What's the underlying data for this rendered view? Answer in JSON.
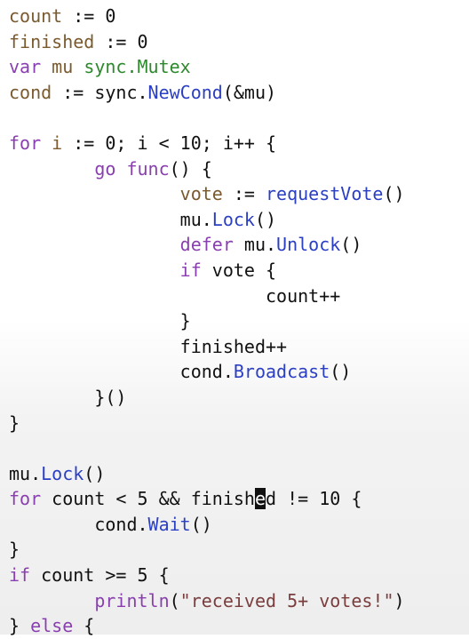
{
  "code": {
    "lines": [
      {
        "tokens": [
          {
            "t": "count",
            "c": "var"
          },
          {
            "t": " := 0",
            "c": "plain"
          }
        ]
      },
      {
        "tokens": [
          {
            "t": "finished",
            "c": "var"
          },
          {
            "t": " := 0",
            "c": "plain"
          }
        ]
      },
      {
        "tokens": [
          {
            "t": "var",
            "c": "kw"
          },
          {
            "t": " ",
            "c": "plain"
          },
          {
            "t": "mu",
            "c": "var"
          },
          {
            "t": " ",
            "c": "plain"
          },
          {
            "t": "sync.Mutex",
            "c": "type"
          }
        ]
      },
      {
        "tokens": [
          {
            "t": "cond",
            "c": "var"
          },
          {
            "t": " := sync.",
            "c": "plain"
          },
          {
            "t": "NewCond",
            "c": "fn"
          },
          {
            "t": "(&mu)",
            "c": "plain"
          }
        ]
      },
      {
        "tokens": []
      },
      {
        "tokens": [
          {
            "t": "for",
            "c": "kw"
          },
          {
            "t": " ",
            "c": "plain"
          },
          {
            "t": "i",
            "c": "var"
          },
          {
            "t": " := 0; i < 10; i++ {",
            "c": "plain"
          }
        ]
      },
      {
        "tokens": [
          {
            "t": "        ",
            "c": "plain"
          },
          {
            "t": "go",
            "c": "kw"
          },
          {
            "t": " ",
            "c": "plain"
          },
          {
            "t": "func",
            "c": "kw"
          },
          {
            "t": "() {",
            "c": "plain"
          }
        ]
      },
      {
        "tokens": [
          {
            "t": "                ",
            "c": "plain"
          },
          {
            "t": "vote",
            "c": "var"
          },
          {
            "t": " := ",
            "c": "plain"
          },
          {
            "t": "requestVote",
            "c": "fn"
          },
          {
            "t": "()",
            "c": "plain"
          }
        ]
      },
      {
        "tokens": [
          {
            "t": "                mu.",
            "c": "plain"
          },
          {
            "t": "Lock",
            "c": "fn"
          },
          {
            "t": "()",
            "c": "plain"
          }
        ]
      },
      {
        "tokens": [
          {
            "t": "                ",
            "c": "plain"
          },
          {
            "t": "defer",
            "c": "kw"
          },
          {
            "t": " mu.",
            "c": "plain"
          },
          {
            "t": "Unlock",
            "c": "fn"
          },
          {
            "t": "()",
            "c": "plain"
          }
        ]
      },
      {
        "tokens": [
          {
            "t": "                ",
            "c": "plain"
          },
          {
            "t": "if",
            "c": "kw"
          },
          {
            "t": " vote {",
            "c": "plain"
          }
        ]
      },
      {
        "tokens": [
          {
            "t": "                        count++",
            "c": "plain"
          }
        ]
      },
      {
        "tokens": [
          {
            "t": "                }",
            "c": "plain"
          }
        ]
      },
      {
        "tokens": [
          {
            "t": "                finished++",
            "c": "plain"
          }
        ]
      },
      {
        "tokens": [
          {
            "t": "                cond.",
            "c": "plain"
          },
          {
            "t": "Broadcast",
            "c": "fn"
          },
          {
            "t": "()",
            "c": "plain"
          }
        ]
      },
      {
        "tokens": [
          {
            "t": "        }()",
            "c": "plain"
          }
        ]
      },
      {
        "tokens": [
          {
            "t": "}",
            "c": "plain"
          }
        ]
      },
      {
        "tokens": []
      },
      {
        "tokens": [
          {
            "t": "mu.",
            "c": "plain"
          },
          {
            "t": "Lock",
            "c": "fn"
          },
          {
            "t": "()",
            "c": "plain"
          }
        ]
      },
      {
        "tokens": [
          {
            "t": "for",
            "c": "kw"
          },
          {
            "t": " count < 5 && finish",
            "c": "plain"
          },
          {
            "t": "e",
            "c": "cursor"
          },
          {
            "t": "d != 10 {",
            "c": "plain"
          }
        ]
      },
      {
        "tokens": [
          {
            "t": "        cond.",
            "c": "plain"
          },
          {
            "t": "Wait",
            "c": "fn"
          },
          {
            "t": "()",
            "c": "plain"
          }
        ]
      },
      {
        "tokens": [
          {
            "t": "}",
            "c": "plain"
          }
        ]
      },
      {
        "tokens": [
          {
            "t": "if",
            "c": "kw"
          },
          {
            "t": " count >= 5 {",
            "c": "plain"
          }
        ]
      },
      {
        "tokens": [
          {
            "t": "        ",
            "c": "plain"
          },
          {
            "t": "println",
            "c": "kw"
          },
          {
            "t": "(",
            "c": "plain"
          },
          {
            "t": "\"received 5+ votes!\"",
            "c": "str"
          },
          {
            "t": ")",
            "c": "plain"
          }
        ]
      },
      {
        "tokens": [
          {
            "t": "} ",
            "c": "plain"
          },
          {
            "t": "else",
            "c": "kw"
          },
          {
            "t": " {",
            "c": "plain"
          }
        ]
      }
    ]
  }
}
